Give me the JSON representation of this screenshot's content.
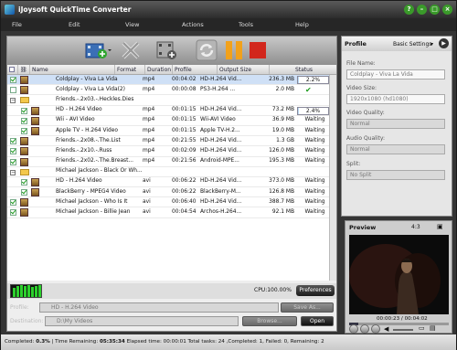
{
  "app": {
    "title": "iJoysoft QuickTime Converter"
  },
  "menu": [
    "File",
    "Edit",
    "View",
    "Actions",
    "Tools",
    "Help"
  ],
  "columns": [
    "Name",
    "Format",
    "Duration",
    "Profile",
    "Output Size",
    "Status"
  ],
  "rows": [
    {
      "type": "file",
      "indent": 0,
      "checked": true,
      "sel": true,
      "name": "Coldplay - Viva La Vida",
      "format": "mp4",
      "duration": "00:04:02",
      "profile": "HD-H.264 Vid...",
      "size": "236.3 MB",
      "status": "2.2%",
      "progress": 0.022
    },
    {
      "type": "file",
      "indent": 0,
      "checked": false,
      "name": "Coldplay - Viva La Vida(2)",
      "format": "mp4",
      "duration": "00:00:08",
      "profile": "PS3-H.264 ...",
      "size": "2.0 MB",
      "status": "",
      "done": true
    },
    {
      "type": "group",
      "name": "Friends.-.2x03.-.Heckles.Dies"
    },
    {
      "type": "file",
      "indent": 1,
      "checked": true,
      "name": "HD - H.264 Video",
      "format": "mp4",
      "duration": "00:01:15",
      "profile": "HD-H.264 Vid...",
      "size": "73.2 MB",
      "status": "2.4%",
      "progress": 0.024
    },
    {
      "type": "file",
      "indent": 1,
      "checked": true,
      "name": "Wii - AVI Video",
      "format": "mp4",
      "duration": "00:01:15",
      "profile": "Wii-AVI Video",
      "size": "36.9 MB",
      "status": "Waiting"
    },
    {
      "type": "file",
      "indent": 1,
      "checked": true,
      "name": "Apple TV - H.264 Video",
      "format": "mp4",
      "duration": "00:01:15",
      "profile": "Apple TV-H.2...",
      "size": "19.0 MB",
      "status": "Waiting"
    },
    {
      "type": "file",
      "indent": 0,
      "checked": true,
      "name": "Friends.-.2x08.-.The.List",
      "format": "mp4",
      "duration": "00:21:55",
      "profile": "HD-H.264 Vid...",
      "size": "1.3 GB",
      "status": "Waiting"
    },
    {
      "type": "file",
      "indent": 0,
      "checked": true,
      "name": "Friends.-.2x10.-.Russ",
      "format": "mp4",
      "duration": "00:02:09",
      "profile": "HD-H.264 Vid...",
      "size": "126.0 MB",
      "status": "Waiting"
    },
    {
      "type": "file",
      "indent": 0,
      "checked": true,
      "name": "Friends.-.2x02.-.The.Breast...",
      "format": "mp4",
      "duration": "00:21:56",
      "profile": "Android-MPE...",
      "size": "195.3 MB",
      "status": "Waiting"
    },
    {
      "type": "group",
      "name": "Michael Jackson - Black Or Wh..."
    },
    {
      "type": "file",
      "indent": 1,
      "checked": true,
      "name": "HD - H.264 Video",
      "format": "avi",
      "duration": "00:06:22",
      "profile": "HD-H.264 Vid...",
      "size": "373.0 MB",
      "status": "Waiting"
    },
    {
      "type": "file",
      "indent": 1,
      "checked": true,
      "name": "BlackBerry - MPEG4 Video",
      "format": "avi",
      "duration": "00:06:22",
      "profile": "BlackBerry-M...",
      "size": "126.8 MB",
      "status": "Waiting"
    },
    {
      "type": "file",
      "indent": 0,
      "checked": true,
      "name": "Michael Jackson - Who Is It",
      "format": "avi",
      "duration": "00:06:40",
      "profile": "HD-H.264 Vid...",
      "size": "388.7 MB",
      "status": "Waiting"
    },
    {
      "type": "file",
      "indent": 0,
      "checked": true,
      "name": "Michael Jackson - Billie Jean",
      "format": "avi",
      "duration": "00:04:54",
      "profile": "Archos-H.264...",
      "size": "92.1 MB",
      "status": "Waiting"
    }
  ],
  "cpu": "CPU:100.00%",
  "preferences": "Preferences",
  "bottom": {
    "profile_label": "Profile:",
    "profile_value": "HD - H.264 Video",
    "save_as": "Save As...",
    "destination_label": "Destination:",
    "destination_value": "D:\\My Videos",
    "browse": "Browse...",
    "open": "Open"
  },
  "status": {
    "completed_label": "Completed:",
    "completed_value": "0.3%",
    "sep": " | Time Remaining: ",
    "remaining": "05:35:34",
    "rest": " Elapsed time: 00:00:01 Total tasks: 24 ,Completed: 1, Failed: 0, Remaining: 2"
  },
  "profile_panel": {
    "title": "Profile",
    "settings": "Basic Settings",
    "file_name_label": "File Name:",
    "file_name_value": "Coldplay - Viva La Vida",
    "video_size_label": "Video Size:",
    "video_size_value": "1920x1080 (hd1080)",
    "video_quality_label": "Video Quality:",
    "video_quality_value": "Normal",
    "audio_quality_label": "Audio Quality:",
    "audio_quality_value": "Normal",
    "split_label": "Split:",
    "split_value": "No Split"
  },
  "preview": {
    "title": "Preview",
    "ratio": "4:3",
    "time": "00:00:23 / 00:04:02",
    "position": 0.095
  }
}
